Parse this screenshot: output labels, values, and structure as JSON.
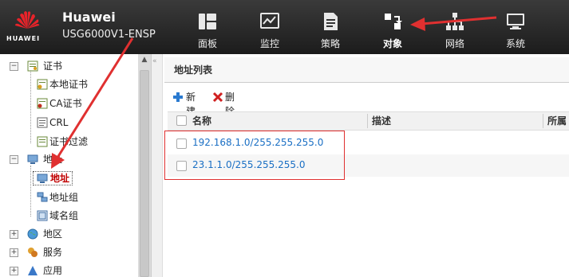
{
  "header": {
    "logo_text": "HUAWEI",
    "brand_name": "Huawei",
    "device_model": "USG6000V1-ENSP",
    "nav": [
      {
        "label": "面板",
        "icon": "dashboard-icon"
      },
      {
        "label": "监控",
        "icon": "monitor-icon"
      },
      {
        "label": "策略",
        "icon": "policy-icon"
      },
      {
        "label": "对象",
        "icon": "object-icon",
        "active": true
      },
      {
        "label": "网络",
        "icon": "network-icon"
      },
      {
        "label": "系统",
        "icon": "system-icon"
      }
    ]
  },
  "sidebar": {
    "items": [
      {
        "label": "证书",
        "expander": "−",
        "icon": "certificate-icon"
      },
      {
        "label": "本地证书",
        "icon": "local-certificate-icon"
      },
      {
        "label": "CA证书",
        "icon": "ca-certificate-icon"
      },
      {
        "label": "CRL",
        "icon": "crl-icon"
      },
      {
        "label": "证书过滤",
        "icon": "certificate-filter-icon"
      },
      {
        "label": "地址",
        "expander": "−",
        "icon": "address-folder-icon"
      },
      {
        "label": "地址",
        "icon": "address-icon",
        "selected": true
      },
      {
        "label": "地址组",
        "icon": "address-group-icon"
      },
      {
        "label": "域名组",
        "icon": "domain-group-icon"
      },
      {
        "label": "地区",
        "expander": "+",
        "icon": "region-icon"
      },
      {
        "label": "服务",
        "expander": "+",
        "icon": "service-icon"
      },
      {
        "label": "应用",
        "expander": "+",
        "icon": "application-icon"
      }
    ]
  },
  "main": {
    "title": "地址列表",
    "toolbar": {
      "new_label": "新建",
      "delete_label": "删除"
    },
    "columns": [
      "名称",
      "描述",
      "所属"
    ],
    "rows": [
      {
        "name": "192.168.1.0/255.255.255.0",
        "description": ""
      },
      {
        "name": "23.1.1.0/255.255.255.0",
        "description": ""
      }
    ]
  },
  "colors": {
    "header_bg": "#2a2a2a",
    "link": "#1a6fc4",
    "active_tree": "#c00000",
    "annotation": "#e03030"
  }
}
